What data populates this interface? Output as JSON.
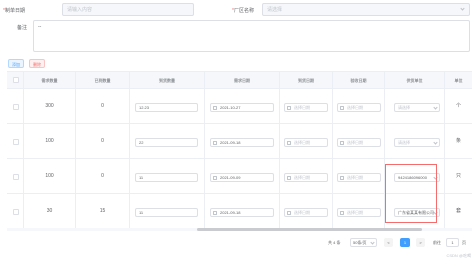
{
  "form": {
    "field1": {
      "label": "制单日期",
      "placeholder": "请输入内容"
    },
    "field2": {
      "label": "厂区名称",
      "placeholder": "请选择"
    },
    "remark": {
      "label": "备注",
      "value": "--"
    }
  },
  "toolbar": {
    "add_label": "添加",
    "delete_label": "删除"
  },
  "table": {
    "columns": [
      "",
      "需求数量",
      "已到数量",
      "到货数量",
      "需求日期",
      "到货日期",
      "验收日期",
      "供货单位",
      "单位"
    ],
    "rows": [
      {
        "demand": "300",
        "arrived": "0",
        "qty": "12.23",
        "demand_date": "2021-10-27",
        "arrive_date_ph": "选择日期",
        "accept_date_ph": "选择日期",
        "supplier": "请选择",
        "supplier_is_ph": true,
        "unit": "个"
      },
      {
        "demand": "100",
        "arrived": "0",
        "qty": "22",
        "demand_date": "2021-09-18",
        "arrive_date_ph": "选择日期",
        "accept_date_ph": "选择日期",
        "supplier": "请选择",
        "supplier_is_ph": true,
        "unit": "条"
      },
      {
        "demand": "100",
        "arrived": "0",
        "qty": "11",
        "demand_date": "2021-09-09",
        "arrive_date_ph": "选择日期",
        "accept_date_ph": "选择日期",
        "supplier": "9424186096000",
        "supplier_is_ph": false,
        "unit": "只"
      },
      {
        "demand": "30",
        "arrived": "15",
        "qty": "11",
        "demand_date": "2021-09-18",
        "arrive_date_ph": "选择日期",
        "accept_date_ph": "选择日期",
        "supplier": "广东省某某有限公司",
        "supplier_is_ph": false,
        "unit": "套"
      }
    ]
  },
  "pagination": {
    "total": "共 4 条",
    "page_size": "50条/页",
    "prev": "<",
    "current": "1",
    "next": ">",
    "goto_label": "前往",
    "goto_value": "1",
    "page_unit": "页"
  },
  "watermark": "CSDN @吃喝"
}
